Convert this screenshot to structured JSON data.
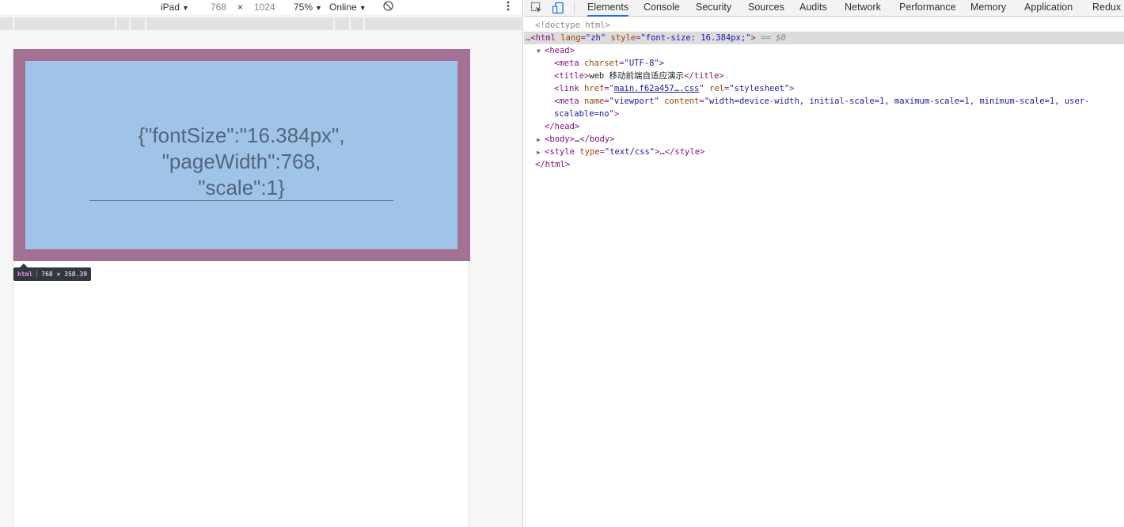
{
  "device_toolbar": {
    "device": "iPad",
    "width": "768",
    "times": "×",
    "height": "1024",
    "zoom": "75%",
    "network": "Online"
  },
  "page": {
    "line1": "{\"fontSize\":\"16.384px\",",
    "line2": "\"pageWidth\":768,",
    "line3": "\"scale\":1}"
  },
  "inspect_tooltip": {
    "tag": "html",
    "size": "768 × 358.39"
  },
  "devtools": {
    "tabs": [
      "Elements",
      "Console",
      "Security",
      "Sources",
      "Audits",
      "Network",
      "Performance",
      "Memory",
      "Application",
      "Redux"
    ],
    "active_tab": "Elements"
  },
  "dom": {
    "doctype": "<!doctype html>",
    "html_open": "<html",
    "html_lang_attr": "lang",
    "html_lang_val": "\"zh\"",
    "html_style_attr": "style",
    "html_style_val": "\"font-size: 16.384px;\"",
    "html_close_bracket": ">",
    "selected_marker": "== $0",
    "head_open": "<head>",
    "meta_charset": {
      "open": "<meta",
      "attr": "charset",
      "val": "\"UTF-8\"",
      "close": ">"
    },
    "title": {
      "open": "<title>",
      "text": "web 移动前端自适应演示",
      "close": "</title>"
    },
    "link": {
      "open": "<link",
      "href_attr": "href",
      "href_val": "main.f62a457….css",
      "rel_attr": "rel",
      "rel_val": "\"stylesheet\"",
      "close": ">"
    },
    "meta_viewport": {
      "open": "<meta",
      "name_attr": "name",
      "name_val": "\"viewport\"",
      "content_attr": "content",
      "content_val_1": "\"width=device-width, initial-scale=1, maximum-scale=1, minimum-scale=1, user-",
      "content_val_2": "scalable=no\"",
      "close": ">"
    },
    "head_close": "</head>",
    "body_open": "<body>",
    "body_ellipsis": "…",
    "body_close": "</body>",
    "style_open": "<style",
    "style_type_attr": "type",
    "style_type_val": "\"text/css\"",
    "style_open_close": ">",
    "style_ellipsis": "…",
    "style_close": "</style>",
    "html_close": "</html>"
  }
}
